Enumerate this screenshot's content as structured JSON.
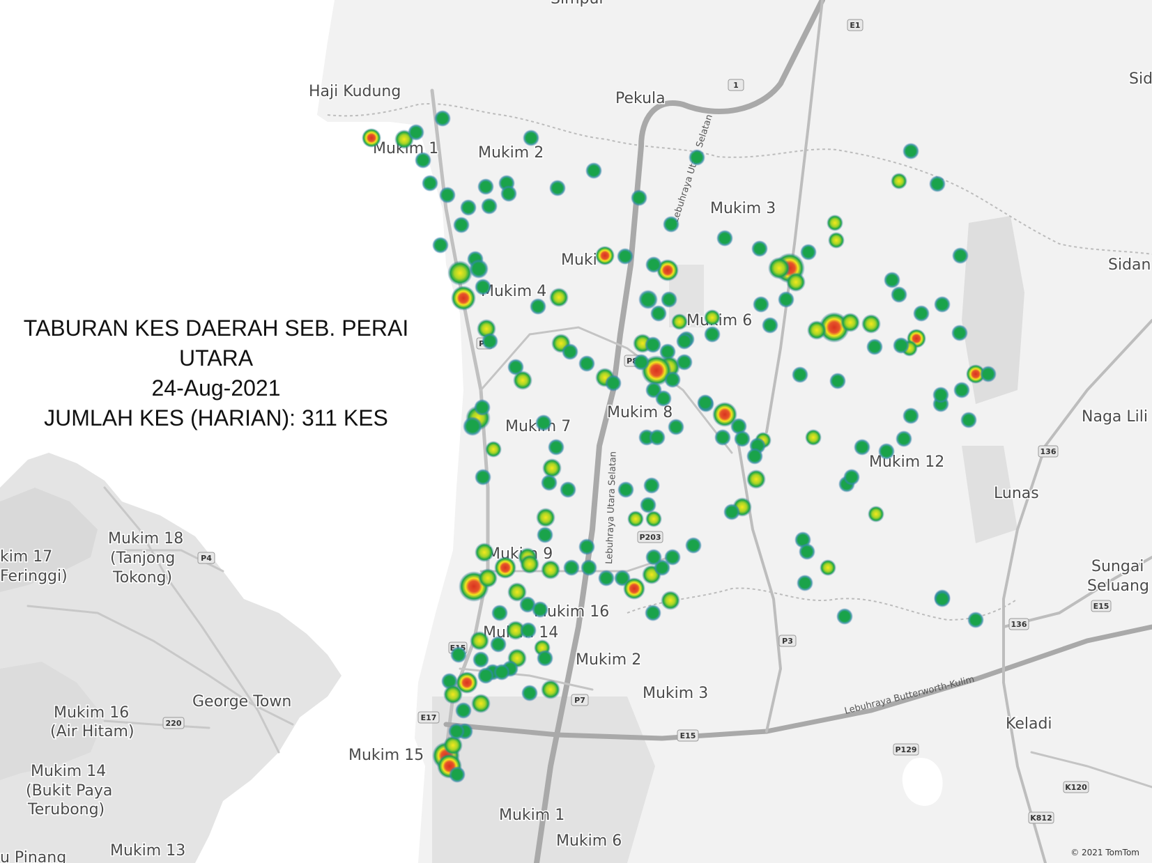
{
  "title": {
    "line1": "TABURAN KES DAERAH SEB. PERAI",
    "line2": "UTARA",
    "date": "24-Aug-2021",
    "total": "JUMLAH KES (HARIAN): 311 KES"
  },
  "copyright": "© 2021 TomTom",
  "colors": {
    "land": "#f2f2f2",
    "water": "#ffffff",
    "road": "#c4c4c4",
    "road_major": "#a9a9a9",
    "heat_low": "#1aa34a",
    "heat_mid": "#f4e71e",
    "heat_high": "#d9331f"
  },
  "place_labels": [
    "Simpul",
    "Haji Kudung",
    "Pekula",
    "Mukim 1",
    "Mukim 2",
    "Mukim 3",
    "Muki",
    "Mukim 4",
    "Mukim 6",
    "Mukim 7",
    "Mukim 8",
    "Mukim 12",
    "Mukim 9",
    "Mukim 16",
    "Mukim 14",
    "Mukim 2",
    "Mukim 3",
    "Mukim 15",
    "Mukim 1",
    "Mukim 6",
    "Naga Lili",
    "Lunas",
    "Sungai",
    "Seluang",
    "Keladi",
    "Sidan",
    "Sid",
    "Mukim 18",
    "(Tanjong",
    "Tokong)",
    "kim 17",
    "Feringgi)",
    "George Town",
    "Mukim 16",
    "(Air Hitam)",
    "Mukim 14",
    "(Bukit Paya",
    "Terubong)",
    "Mukim 13",
    "u Pinang"
  ],
  "road_labels": [
    "Lebuhraya Utara Selatan",
    "Lebuhraya Utara Selatan",
    "Lebuhraya Butterworth-Kulim"
  ],
  "shields": [
    "E1",
    "1",
    "P1",
    "P8",
    "P203",
    "P3",
    "P4",
    "E15",
    "220",
    "E17",
    "P7",
    "E15",
    "P129",
    "136",
    "136",
    "E15",
    "K120",
    "K812",
    "E15"
  ]
}
